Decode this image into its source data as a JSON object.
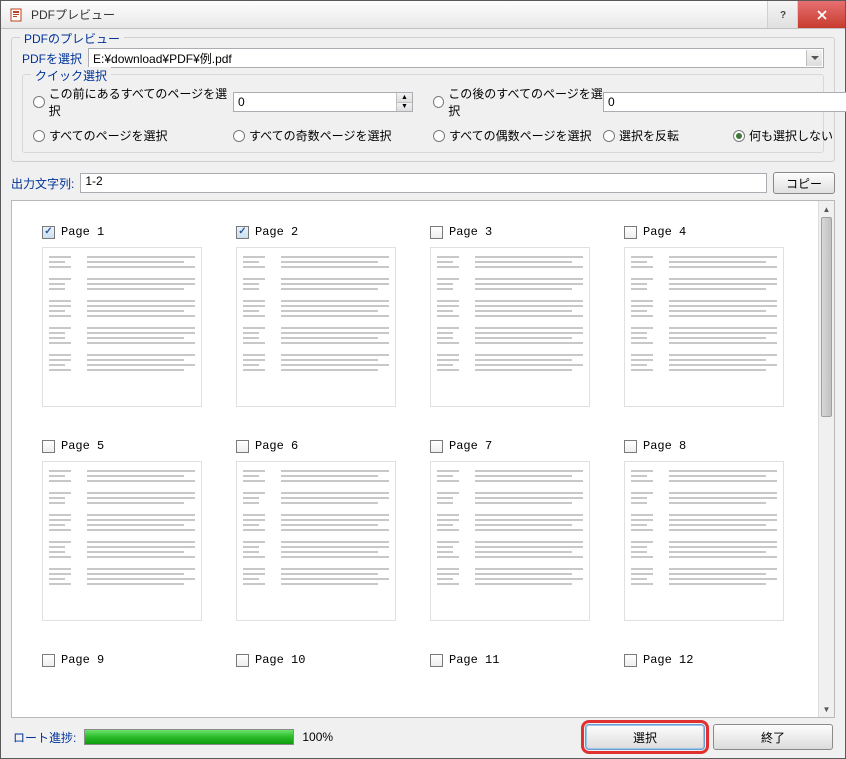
{
  "window": {
    "title": "PDFプレビュー"
  },
  "groupbox": {
    "legend": "PDFのプレビュー",
    "select_label": "PDFを選択",
    "file_path": "E:¥download¥PDF¥例.pdf",
    "quick_legend": "クイック選択",
    "radios": {
      "before": "この前にあるすべてのページを選択",
      "after": "この後のすべてのページを選択",
      "all": "すべてのページを選択",
      "odd": "すべての奇数ページを選択",
      "even": "すべての偶数ページを選択",
      "invert": "選択を反転",
      "none": "何も選択しない"
    },
    "spinner_before": "0",
    "spinner_after": "0"
  },
  "output": {
    "label": "出力文字列:",
    "value": "1-2",
    "copy_btn": "コピー"
  },
  "pages": [
    {
      "label": "Page 1",
      "checked": true
    },
    {
      "label": "Page 2",
      "checked": true
    },
    {
      "label": "Page 3",
      "checked": false
    },
    {
      "label": "Page 4",
      "checked": false
    },
    {
      "label": "Page 5",
      "checked": false
    },
    {
      "label": "Page 6",
      "checked": false
    },
    {
      "label": "Page 7",
      "checked": false
    },
    {
      "label": "Page 8",
      "checked": false
    },
    {
      "label": "Page 9",
      "checked": false
    },
    {
      "label": "Page 10",
      "checked": false
    },
    {
      "label": "Page 11",
      "checked": false
    },
    {
      "label": "Page 12",
      "checked": false
    }
  ],
  "footer": {
    "progress_label": "ロート進捗:",
    "progress_text": "100%",
    "select_btn": "選択",
    "exit_btn": "終了"
  }
}
